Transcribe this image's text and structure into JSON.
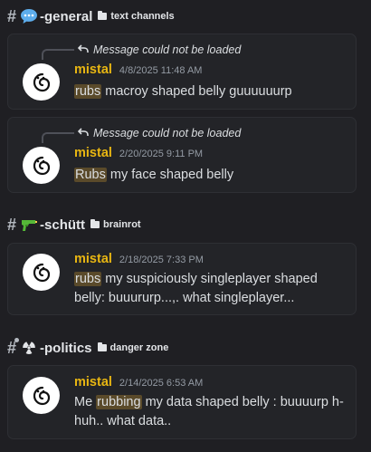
{
  "sections": [
    {
      "channel_emoji": "speech-bubble-emoji",
      "channel_name": "-general",
      "category": "text channels",
      "messages": [
        {
          "reply_text": "Message could not be loaded",
          "author": "mistal",
          "timestamp": "4/8/2025 11:48 AM",
          "highlight": "rubs",
          "rest": " macroy shaped belly guuuuuurp"
        },
        {
          "reply_text": "Message could not be loaded",
          "author": "mistal",
          "timestamp": "2/20/2025 9:11 PM",
          "highlight": "Rubs",
          "rest": " my face shaped belly"
        }
      ]
    },
    {
      "channel_emoji": "water-pistol-emoji",
      "channel_name": "-schütt",
      "category": "brainrot",
      "messages": [
        {
          "author": "mistal",
          "timestamp": "2/18/2025 7:33 PM",
          "highlight": "rubs",
          "rest": " my suspiciously singleplayer shaped belly: buuururp...,. what singleplayer..."
        }
      ]
    },
    {
      "channel_emoji": "radioactive-emoji",
      "channel_name": "-politics",
      "category": "danger zone",
      "messages": [
        {
          "author": "mistal",
          "timestamp": "2/14/2025 6:53 AM",
          "before": "Me ",
          "highlight": "rubbing",
          "rest": " my data shaped belly : buuuurp h-huh.. what data.."
        }
      ]
    }
  ]
}
